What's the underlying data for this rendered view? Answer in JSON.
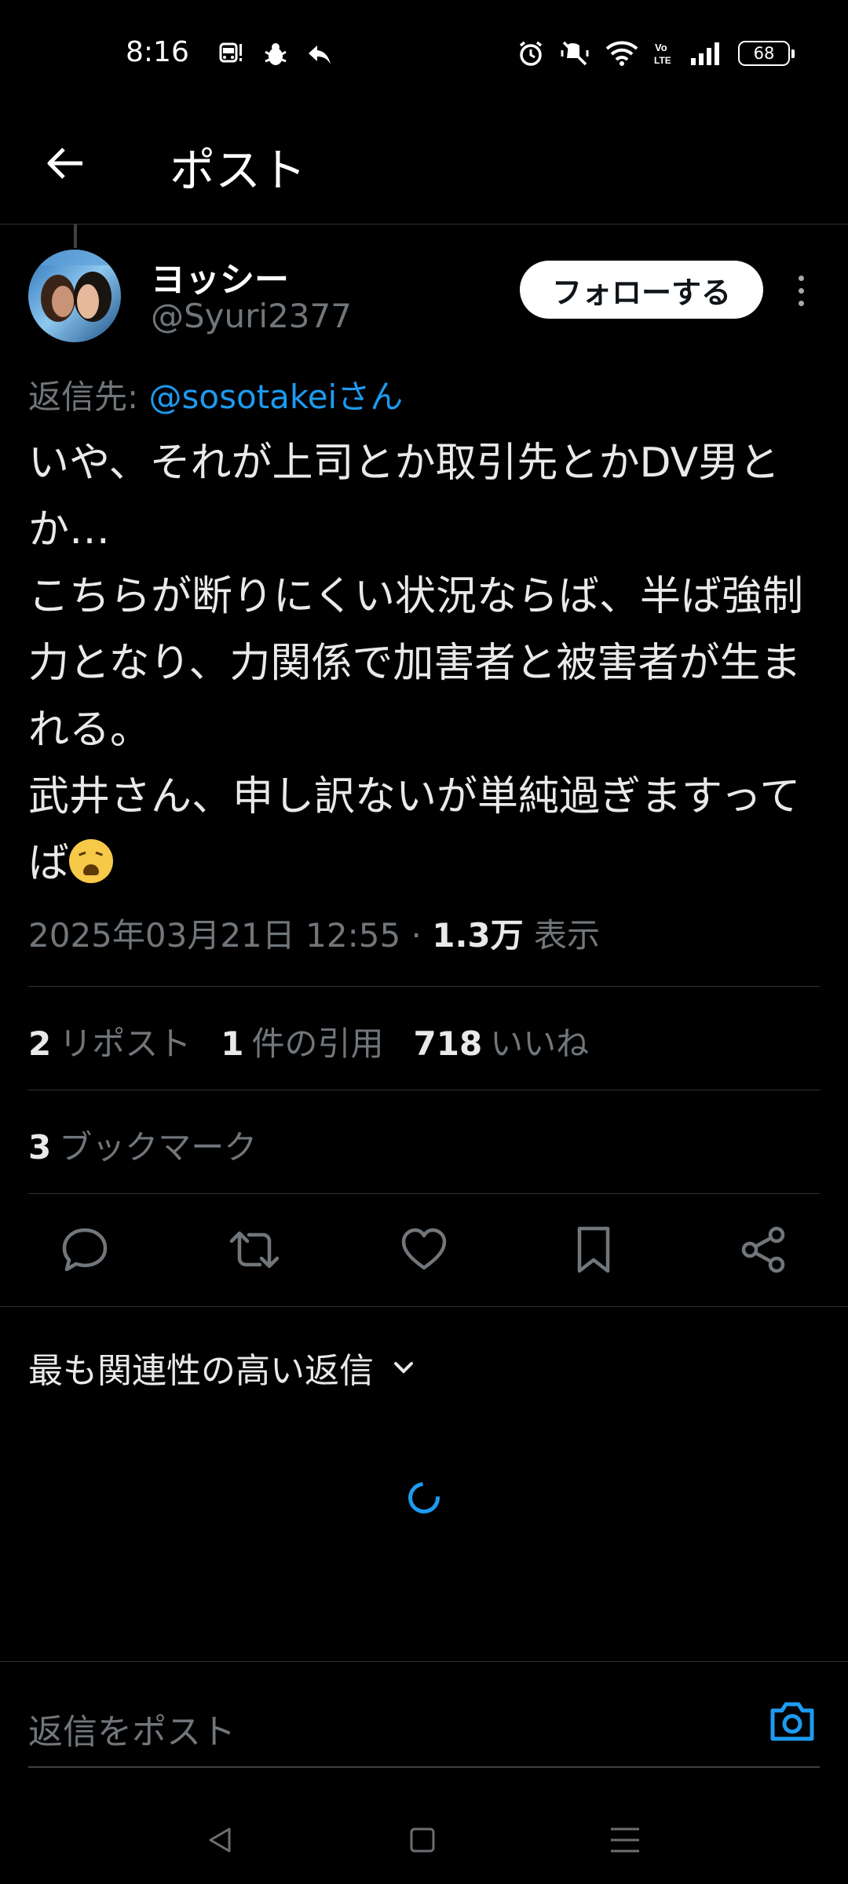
{
  "status_bar": {
    "time": "8:16",
    "battery": "68",
    "notif_icons": [
      "bus-alert-icon",
      "bug-icon",
      "reply-arrow-icon"
    ],
    "system_icons": [
      "alarm-icon",
      "vibrate-off-icon",
      "wifi-icon",
      "volte-icon",
      "signal-icon"
    ]
  },
  "header": {
    "title": "ポスト"
  },
  "post": {
    "author_name": "ヨッシー",
    "author_handle": "@Syuri2377",
    "follow_label": "フォローする",
    "reply_prefix": "返信先: ",
    "reply_mention": "@sosotakeiさん",
    "body": "いや、それが上司とか取引先とかDV男とか…\nこちらが断りにくい状況ならば、半ば強制力となり、力関係で加害者と被害者が生まれる。\n武井さん、申し訳ないが単純過ぎますってば",
    "timestamp": "2025年03月21日 12:55 · ",
    "views_count": "1.3万",
    "views_label": "表示"
  },
  "stats": {
    "reposts_count": "2",
    "reposts_label": "リポスト",
    "quotes_count": "1",
    "quotes_label": "件の引用",
    "likes_count": "718",
    "likes_label": "いいね",
    "bookmarks_count": "3",
    "bookmarks_label": "ブックマーク"
  },
  "replies": {
    "sort_label": "最も関連性の高い返信"
  },
  "composer": {
    "placeholder": "返信をポスト"
  },
  "colors": {
    "accent": "#1d9bf0",
    "background": "#000000",
    "muted": "#71767b",
    "divider": "#2f3336"
  }
}
